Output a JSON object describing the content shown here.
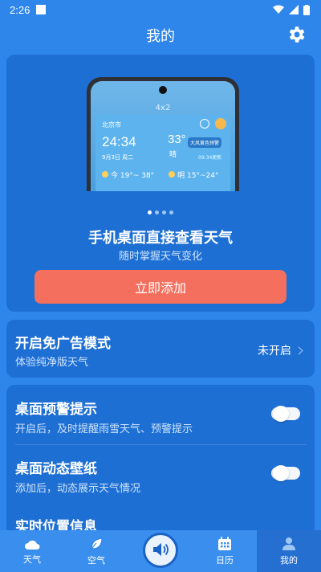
{
  "status_bar": {
    "time": "2:26"
  },
  "header": {
    "title": "我的"
  },
  "promo": {
    "widget_size": "4x2",
    "widget": {
      "city": "北京市",
      "time": "24:34",
      "temp": "33°",
      "condition": "晴",
      "date": "9月3日 周二",
      "alert": "大风黄色预警",
      "update": "09:34更新",
      "today": "今 19°~ 38°",
      "tomorrow": "明 15°~24°"
    },
    "title": "手机桌面直接查看天气",
    "subtitle": "随时掌握天气变化",
    "button": "立即添加",
    "page_count": 4,
    "active_page": 0
  },
  "adfree": {
    "title": "开启免广告模式",
    "subtitle": "体验纯净版天气",
    "status": "未开启"
  },
  "settings": [
    {
      "title": "桌面预警提示",
      "subtitle": "开启后，及时提醒雨雪天气、预警提示",
      "enabled": false
    },
    {
      "title": "桌面动态壁纸",
      "subtitle": "添加后，动态展示天气情况",
      "enabled": false
    },
    {
      "title": "实时位置信息",
      "subtitle": ""
    }
  ],
  "nav": {
    "weather": "天气",
    "air": "空气",
    "calendar": "日历",
    "mine": "我的"
  },
  "colors": {
    "accent": "#2e86ea",
    "button": "#f46f5e"
  }
}
